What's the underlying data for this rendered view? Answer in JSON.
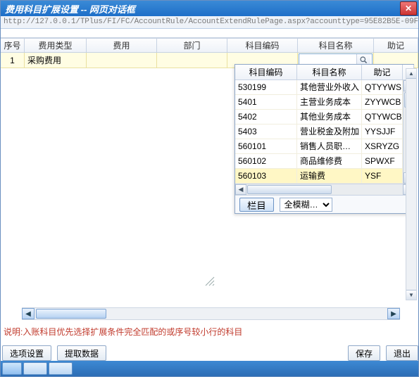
{
  "window": {
    "title": "费用科目扩展设置 -- 网页对话框",
    "close_icon": "✕"
  },
  "url": "http://127.0.0.1/TPlus/FI/FC/AccountRule/AccountExtendRulePage.aspx?accounttype=95E82B5E-09FA-4",
  "grid": {
    "headers": {
      "seq": "序号",
      "type": "费用类型",
      "fee": "费用",
      "dept": "部门",
      "code": "科目编码",
      "name": "科目名称",
      "rest": "助记"
    },
    "row": {
      "seq": "1",
      "type": "采购费用",
      "fee": "",
      "dept": "",
      "code": "",
      "name_value": ""
    }
  },
  "popup": {
    "headers": {
      "code": "科目编码",
      "name": "科目名称",
      "help": "助记"
    },
    "rows": [
      {
        "code": "530199",
        "name": "其他营业外收入",
        "help": "QTYYWS"
      },
      {
        "code": "5401",
        "name": "主营业务成本",
        "help": "ZYYWCB"
      },
      {
        "code": "5402",
        "name": "其他业务成本",
        "help": "QTYWCB"
      },
      {
        "code": "5403",
        "name": "营业税金及附加",
        "help": "YYSJJF"
      },
      {
        "code": "560101",
        "name": "销售人员职…",
        "help": "XSRYZG"
      },
      {
        "code": "560102",
        "name": "商品维修费",
        "help": "SPWXF"
      },
      {
        "code": "560103",
        "name": "运输费",
        "help": "YSF",
        "selected": true
      }
    ],
    "foot": {
      "btn": "栏目",
      "mode": "全模糊…"
    }
  },
  "note": "说明:入账科目优先选择扩展条件完全匹配的或序号较小行的科目",
  "buttons": {
    "opt": "选项设置",
    "fetch": "提取数据",
    "save": "保存",
    "exit": "退出"
  }
}
